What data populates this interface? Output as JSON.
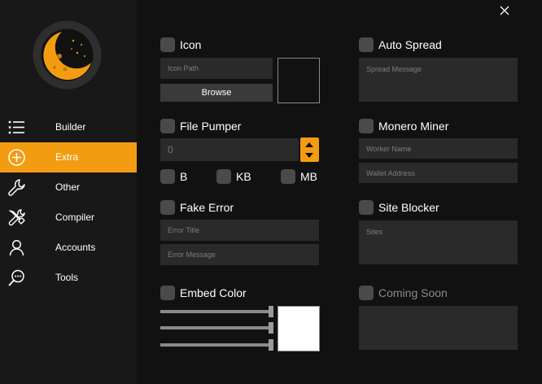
{
  "window": {
    "close_symbol": "×"
  },
  "colors": {
    "accent": "#f39c12",
    "sidebar_bg": "#181818",
    "main_bg": "#111111",
    "field_bg": "#2a2a2a"
  },
  "sidebar": {
    "logo_icon": "crescent-moon-logo-icon",
    "items": [
      {
        "label": "Builder",
        "icon": "list-icon",
        "active": false
      },
      {
        "label": "Extra",
        "icon": "plus-circle-icon",
        "active": true
      },
      {
        "label": "Other",
        "icon": "wrench-icon",
        "active": false
      },
      {
        "label": "Compiler",
        "icon": "tools-icon",
        "active": false
      },
      {
        "label": "Accounts",
        "icon": "user-icon",
        "active": false
      },
      {
        "label": "Tools",
        "icon": "chat-search-icon",
        "active": false
      }
    ]
  },
  "icon_section": {
    "label": "Icon",
    "path_placeholder": "Icon Path",
    "browse_label": "Browse"
  },
  "file_pumper": {
    "label": "File Pumper",
    "value": "0",
    "units": [
      "B",
      "KB",
      "MB"
    ]
  },
  "fake_error": {
    "label": "Fake Error",
    "title_placeholder": "Error Title",
    "message_placeholder": "Error Message"
  },
  "embed_color": {
    "label": "Embed Color",
    "rgb_levels": [
      1.0,
      1.0,
      1.0
    ],
    "preview_color": "#ffffff"
  },
  "auto_spread": {
    "label": "Auto Spread",
    "message_placeholder": "Spread Message"
  },
  "monero_miner": {
    "label": "Monero Miner",
    "worker_placeholder": "Worker Name",
    "wallet_placeholder": "Wallet Address"
  },
  "site_blocker": {
    "label": "Site Blocker",
    "sites_placeholder": "Sites"
  },
  "coming_soon": {
    "label": "Coming Soon"
  }
}
